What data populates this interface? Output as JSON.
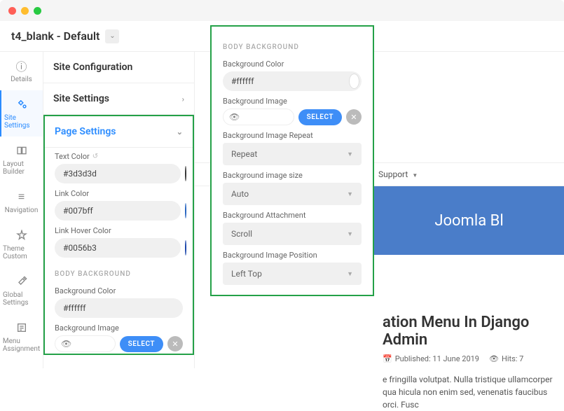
{
  "window": {
    "title": "t4_blank - Default"
  },
  "rail": [
    {
      "icon": "ⓘ",
      "label": "Details"
    },
    {
      "icon": "⚙",
      "label": "Site Settings"
    },
    {
      "icon": "▭",
      "label": "Layout Builder"
    },
    {
      "icon": "≡",
      "label": "Navigation"
    },
    {
      "icon": "✎",
      "label": "Theme Custom"
    },
    {
      "icon": "✕",
      "label": "Global Settings"
    },
    {
      "icon": "☰",
      "label": "Menu Assignment"
    }
  ],
  "sections": {
    "site_config": "Site Configuration",
    "site_settings": "Site Settings",
    "page_settings": "Page Settings"
  },
  "page_settings": {
    "text_color_label": "Text Color",
    "text_color_value": "#3d3d3d",
    "link_color_label": "Link Color",
    "link_color_value": "#007bff",
    "link_hover_label": "Link Hover Color",
    "link_hover_value": "#0056b3",
    "body_bg_header": "BODY BACKGROUND",
    "bg_color_label": "Background Color",
    "bg_color_value": "#ffffff",
    "bg_image_label": "Background Image",
    "select_btn": "SELECT"
  },
  "float": {
    "header": "BODY BACKGROUND",
    "bg_color_label": "Background Color",
    "bg_color_value": "#ffffff",
    "bg_image_label": "Background Image",
    "select_btn": "SELECT",
    "repeat_label": "Background Image Repeat",
    "repeat_value": "Repeat",
    "size_label": "Background image size",
    "size_value": "Auto",
    "attach_label": "Background Attachment",
    "attach_value": "Scroll",
    "pos_label": "Background Image Position",
    "pos_value": "Left Top"
  },
  "preview": {
    "nav_item": "Support",
    "banner": "Joomla Bl",
    "article_title": "ation Menu In Django Admin",
    "pub_label": "Published: 11 June 2019",
    "hits_label": "Hits: 7",
    "body": "e fringilla volutpat. Nulla tristique ullamcorper qua hicula non enim sed, venenatis faucibus orci. Fusc"
  },
  "colors": {
    "text": "#3d3d3d",
    "link": "#2b70d6",
    "hover": "#1d4fbf"
  }
}
